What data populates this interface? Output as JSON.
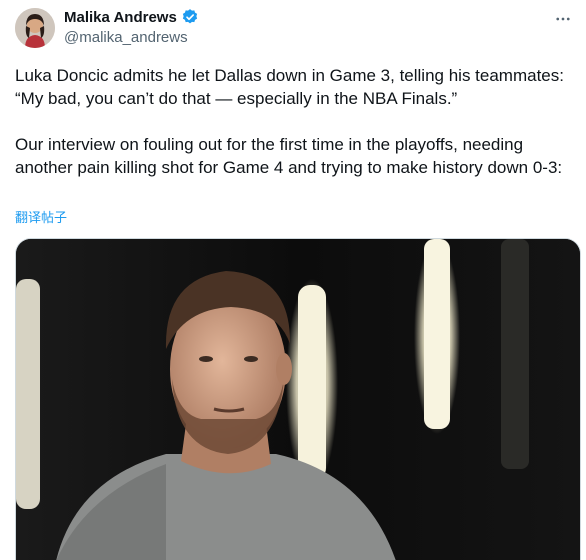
{
  "author": {
    "display_name": "Malika Andrews",
    "handle": "@malika_andrews",
    "verified": true
  },
  "tweet": {
    "text": "Luka Doncic admits he let Dallas down in Game 3, telling his teammates: “My bad, you can’t do that — especially in the NBA Finals.”\n\nOur interview on fouling out for the first time in the playoffs, needing another pain killing shot for Game 4 and trying to make history down 0-3:",
    "translate_label": "翻译帖子"
  },
  "icons": {
    "verified": "verified-badge-icon",
    "more": "more-options-icon"
  },
  "colors": {
    "link": "#1d9bf0",
    "verified": "#1d9bf0",
    "text": "#0f1419",
    "muted": "#536471"
  }
}
